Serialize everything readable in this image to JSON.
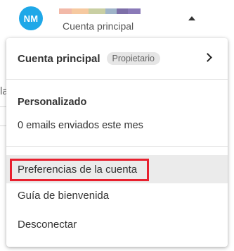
{
  "header": {
    "avatar_initials": "NM",
    "avatar_color": "#1fa8e8",
    "account_subtitle": "Cuenta principal",
    "redacted_name_colors": [
      "#f2b9a8",
      "#f6c9a0",
      "#c9cfa3",
      "#9fb4c9",
      "#7d6fa8",
      "#8a7ab8"
    ]
  },
  "background": {
    "left_char": "la"
  },
  "dropdown": {
    "account": {
      "label": "Cuenta principal",
      "role_badge": "Propietario"
    },
    "section_title": "Personalizado",
    "emails_sent": "0 emails enviados este mes",
    "items": [
      {
        "label": "Preferencias de la cuenta",
        "active": true
      },
      {
        "label": "Guía de bienvenida",
        "active": false
      },
      {
        "label": "Desconectar",
        "active": false
      }
    ],
    "highlight_color": "#e8202e"
  }
}
